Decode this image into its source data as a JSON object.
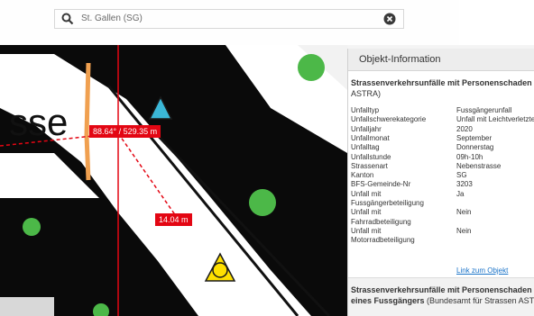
{
  "search": {
    "value": "St. Gallen (SG)"
  },
  "map": {
    "street_text": "sse",
    "measure_angle_distance": "88.64° / 529.35 m",
    "measure_distance": "14.04 m"
  },
  "panel": {
    "title": "Objekt-Information",
    "section1": {
      "title_bold": "Strassenverkehrsunfälle mit Personenschaden (",
      "title_source": "ASTRA)"
    },
    "rows": [
      {
        "key": "Unfalltyp",
        "value": "Fussgängerunfall"
      },
      {
        "key": "Unfallschwerekategorie",
        "value": "Unfall mit Leichtverletzte"
      },
      {
        "key": "Unfalljahr",
        "value": "2020"
      },
      {
        "key": "Unfallmonat",
        "value": "September"
      },
      {
        "key": "Unfalltag",
        "value": "Donnerstag"
      },
      {
        "key": "Unfallstunde",
        "value": "09h-10h"
      },
      {
        "key": "Strassenart",
        "value": "Nebenstrasse"
      },
      {
        "key": "Kanton",
        "value": "SG"
      },
      {
        "key": "BFS-Gemeinde-Nr",
        "value": "3203"
      },
      {
        "key": "Unfall mit",
        "value": "Ja"
      },
      {
        "key": "Fussgängerbeteiligung",
        "value": ""
      },
      {
        "key": "Unfall mit",
        "value": "Nein"
      },
      {
        "key": "Fahrradbeteiligung",
        "value": ""
      },
      {
        "key": "Unfall mit",
        "value": "Nein"
      },
      {
        "key": "Motorradbeteiligung",
        "value": ""
      }
    ],
    "link": "Link zum Objekt",
    "section2": {
      "line1": "Strassenverkehrsunfälle mit Personenschaden u",
      "line2_bold": "eines Fussgängers",
      "line2_rest": " (Bundesamt für Strassen ASTRA"
    }
  },
  "colors": {
    "measure": "#e30613",
    "marker_triangle": "#3bb8d8",
    "marker_yellow": "#ffe000",
    "green_dot": "#4cb848"
  }
}
